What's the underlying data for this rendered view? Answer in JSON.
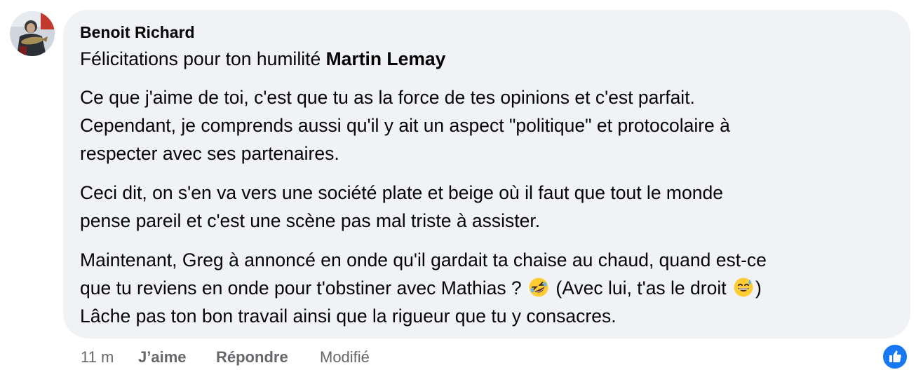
{
  "comment": {
    "author": "Benoit Richard",
    "intro_text": "Félicitations pour ton humilité ",
    "mention": "Martin Lemay",
    "paragraph1_line1": "Ce que j'aime de toi, c'est que tu as la force de tes opinions et c'est parfait.",
    "paragraph1_line2": "Cependant, je comprends aussi qu'il y ait un aspect \"politique\" et protocolaire à",
    "paragraph1_line3": "respecter avec ses partenaires.",
    "paragraph2_line1": "Ceci dit, on s'en va vers une société plate et beige où il faut que tout le monde",
    "paragraph2_line2": "pense pareil et c'est une scène pas mal triste à assister.",
    "paragraph3_line1": "Maintenant, Greg à annoncé en onde qu'il gardait ta chaise au chaud, quand est-ce",
    "paragraph3_line2_a": "que tu reviens en onde pour t'obstiner avec Mathias ? ",
    "paragraph3_line2_b": " (Avec lui, t'as le droit ",
    "paragraph3_line2_c": ")",
    "paragraph3_line3": "Lâche pas ton bon travail ainsi que la rigueur que tu y consacres.",
    "emoji1": "rolling-on-floor-laughing",
    "emoji2": "grinning-sweat"
  },
  "actions": {
    "time": "11 m",
    "like": "J’aime",
    "reply": "Répondre",
    "edited": "Modifié"
  },
  "reaction": {
    "icon": "thumbs-up-icon",
    "color": "#1877f2"
  },
  "colors": {
    "bubble": "#f0f2f5",
    "text": "#050505",
    "meta": "#65676b"
  }
}
